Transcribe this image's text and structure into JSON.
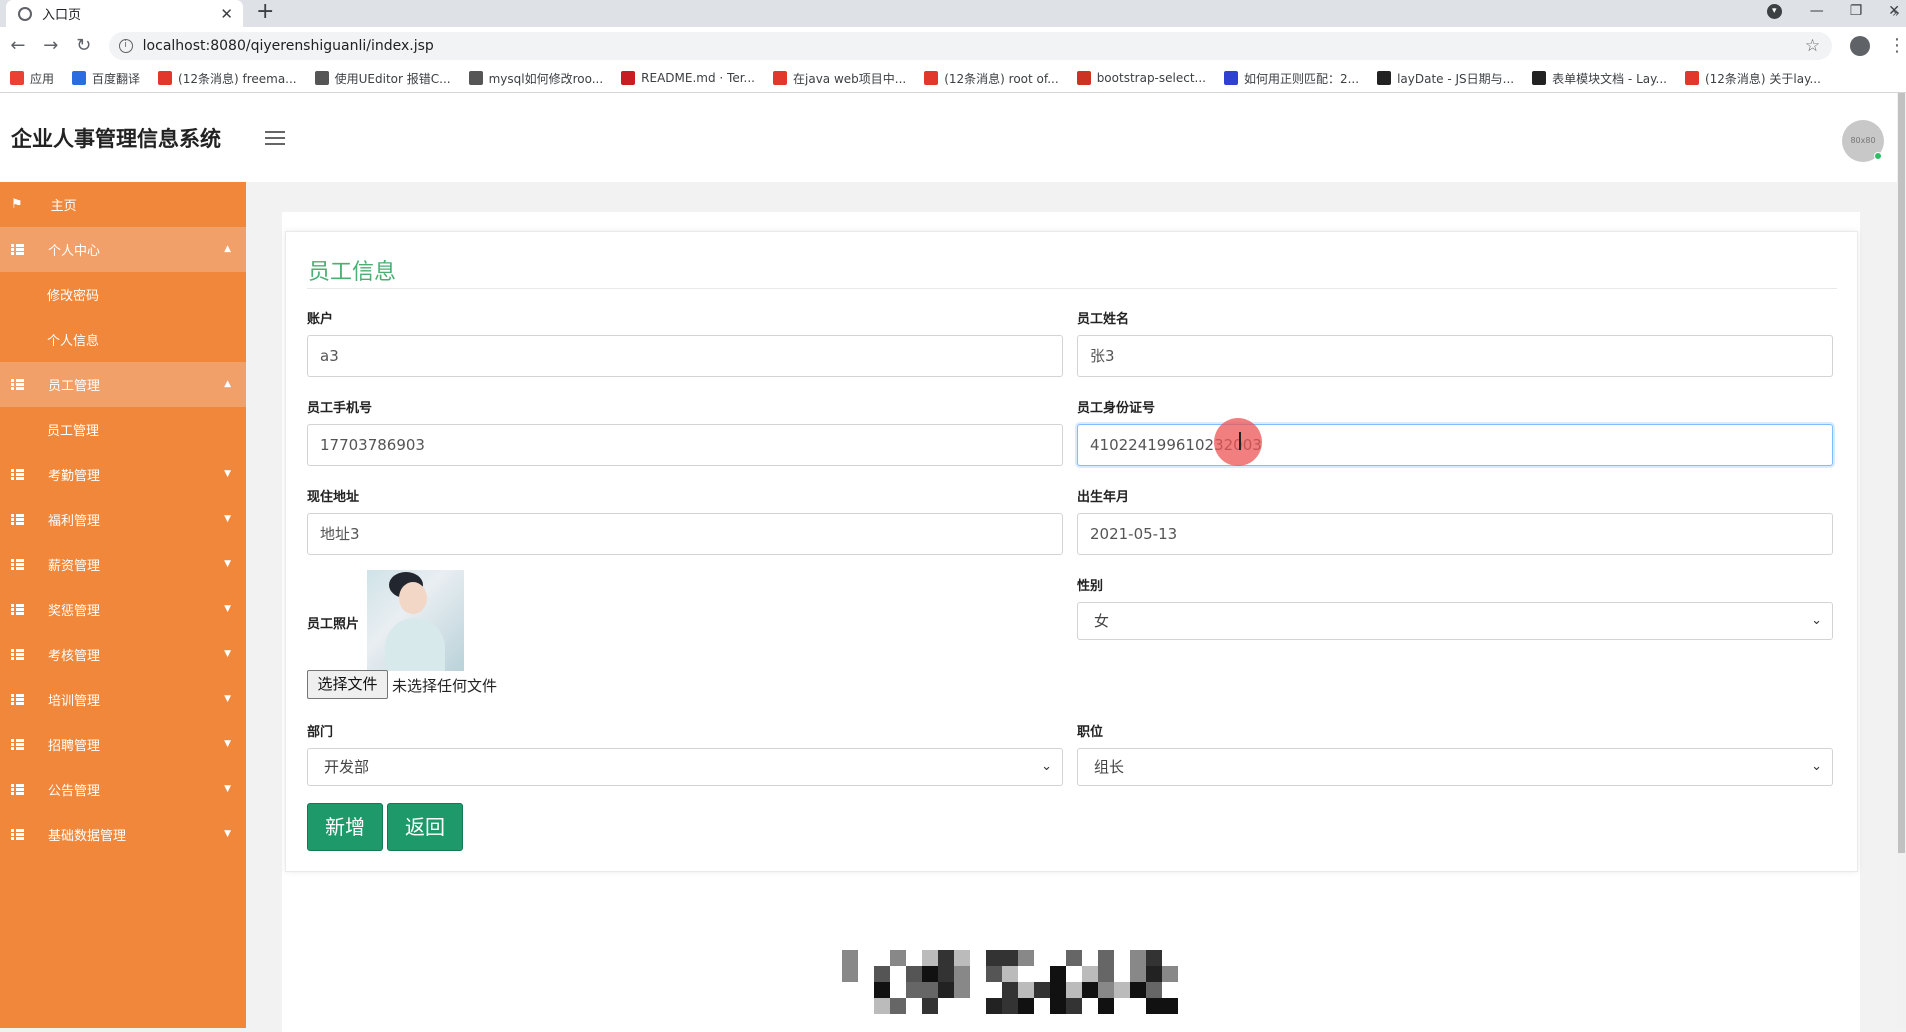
{
  "browser": {
    "tab_title": "入口页",
    "url": "localhost:8080/qiyerenshiguanli/index.jsp",
    "bookmarks": [
      {
        "icon": "apps-icon",
        "label": "应用",
        "color": "#e94235"
      },
      {
        "icon": "translate-icon",
        "label": "百度翻译",
        "color": "#2b6de0"
      },
      {
        "icon": "csdn-icon",
        "label": "(12条消息) freema...",
        "color": "#e1382b"
      },
      {
        "icon": "ueditor-icon",
        "label": "使用UEditor 报错C...",
        "color": "#555555"
      },
      {
        "icon": "mysql-icon",
        "label": "mysql如何修改roo...",
        "color": "#555555"
      },
      {
        "icon": "gitee-icon",
        "label": "README.md · Ter...",
        "color": "#c71d23"
      },
      {
        "icon": "csdn-icon",
        "label": "在java web项目中...",
        "color": "#e1382b"
      },
      {
        "icon": "csdn-icon",
        "label": "(12条消息) root of...",
        "color": "#e1382b"
      },
      {
        "icon": "bootstrap-icon",
        "label": "bootstrap-select...",
        "color": "#cc3322"
      },
      {
        "icon": "baidu-icon",
        "label": "如何用正则匹配：2...",
        "color": "#3040d0"
      },
      {
        "icon": "layui-icon",
        "label": "layDate - JS日期与...",
        "color": "#222222"
      },
      {
        "icon": "layui-icon",
        "label": "表单模块文档 - Lay...",
        "color": "#222222"
      },
      {
        "icon": "csdn-icon",
        "label": "(12条消息) 关于lay...",
        "color": "#e1382b"
      }
    ]
  },
  "app": {
    "title": "企业人事管理信息系统",
    "avatar_text": "80x80"
  },
  "sidebar": {
    "items": [
      {
        "label": "主页"
      },
      {
        "label": "个人中心"
      },
      {
        "label": "修改密码"
      },
      {
        "label": "个人信息"
      },
      {
        "label": "员工管理"
      },
      {
        "label": "员工管理"
      },
      {
        "label": "考勤管理"
      },
      {
        "label": "福利管理"
      },
      {
        "label": "薪资管理"
      },
      {
        "label": "奖惩管理"
      },
      {
        "label": "考核管理"
      },
      {
        "label": "培训管理"
      },
      {
        "label": "招聘管理"
      },
      {
        "label": "公告管理"
      },
      {
        "label": "基础数据管理"
      }
    ]
  },
  "form": {
    "title": "员工信息",
    "account_label": "账户",
    "account_value": "a3",
    "name_label": "员工姓名",
    "name_value": "张3",
    "phone_label": "员工手机号",
    "phone_value": "17703786903",
    "idcard_label": "员工身份证号",
    "idcard_value": "410224199610232003",
    "address_label": "现住地址",
    "address_value": "地址3",
    "birth_label": "出生年月",
    "birth_value": "2021-05-13",
    "photo_label": "员工照片",
    "file_button": "选择文件",
    "file_status": "未选择任何文件",
    "gender_label": "性别",
    "gender_value": "女",
    "dept_label": "部门",
    "dept_value": "开发部",
    "position_label": "职位",
    "position_value": "组长",
    "submit_label": "新增",
    "back_label": "返回"
  },
  "colors": {
    "sidebar": "#f0873a",
    "sidebar_active": "#f2a06a",
    "title_green": "#4caf72",
    "button_green": "#1e9a6a"
  }
}
